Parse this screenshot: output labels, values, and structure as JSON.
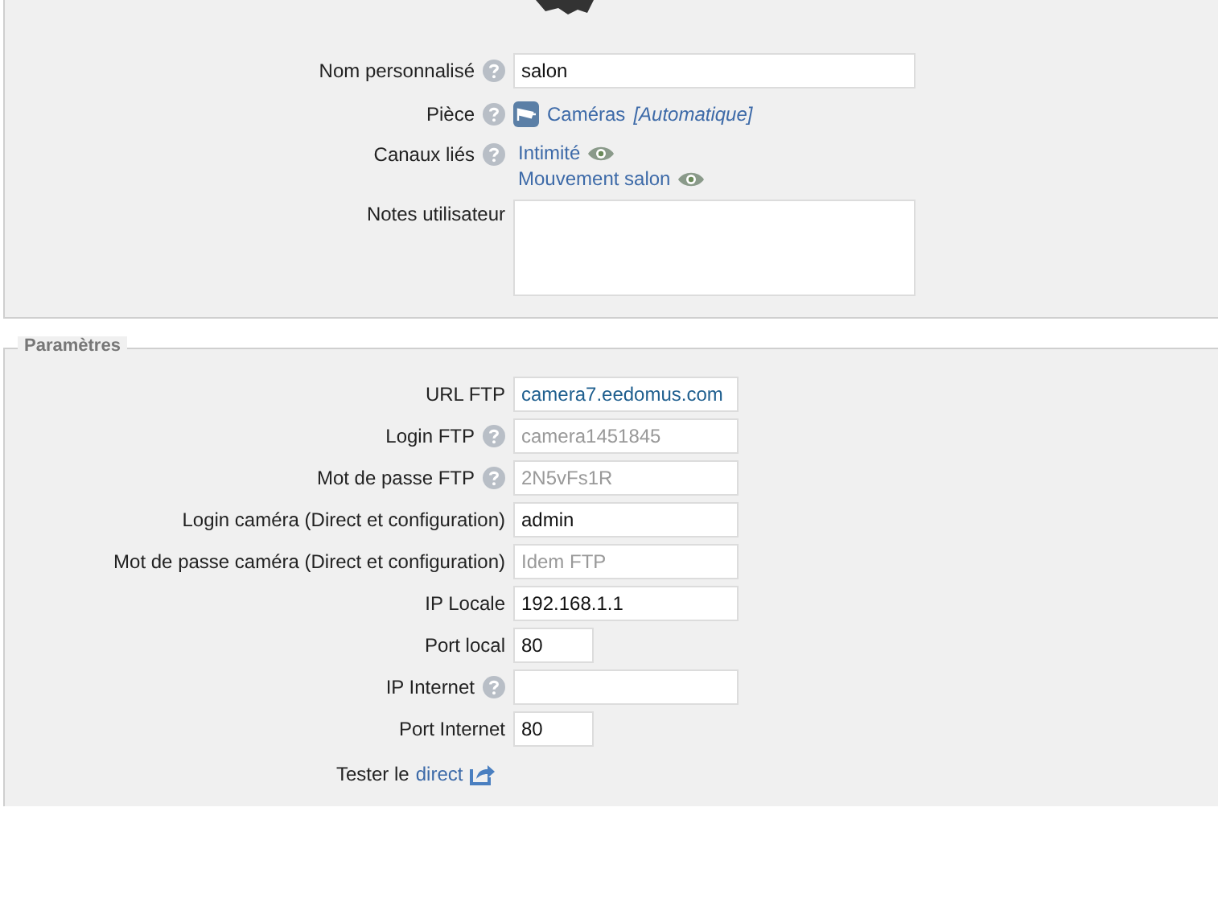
{
  "top": {
    "fields": [
      {
        "kind": "text",
        "label": "Nom personnalisé",
        "help": true,
        "value": "salon"
      },
      {
        "kind": "room",
        "label": "Pièce",
        "help": true,
        "link": "Caméras",
        "note": "[Automatique]"
      },
      {
        "kind": "channels",
        "label": "Canaux liés",
        "help": true,
        "items": [
          "Intimité",
          "Mouvement salon"
        ]
      },
      {
        "kind": "textarea",
        "label": "Notes utilisateur",
        "help": false
      }
    ]
  },
  "parameters": {
    "legend": "Paramètres",
    "fields": [
      {
        "kind": "url",
        "label": "URL FTP",
        "help": false,
        "value": "camera7.eedomus.com"
      },
      {
        "kind": "entry",
        "label": "Login FTP",
        "help": true,
        "placeholder": "camera1451845"
      },
      {
        "kind": "entry",
        "label": "Mot de passe FTP",
        "help": true,
        "placeholder": "2N5vFs1R"
      },
      {
        "kind": "entry",
        "label": "Login caméra (Direct et configuration)",
        "help": false,
        "value": "admin"
      },
      {
        "kind": "entry",
        "label": "Mot de passe caméra (Direct et configuration)",
        "help": false,
        "placeholder": "Idem FTP"
      },
      {
        "kind": "entry",
        "label": "IP Locale",
        "help": false,
        "value": "192.168.1.1"
      },
      {
        "kind": "port",
        "label": "Port local",
        "help": false,
        "value": "80"
      },
      {
        "kind": "entry",
        "label": "IP Internet",
        "help": true
      },
      {
        "kind": "port",
        "label": "Port Internet",
        "help": false,
        "value": "80"
      }
    ],
    "test": {
      "label": "Tester le",
      "link": "direct"
    }
  }
}
